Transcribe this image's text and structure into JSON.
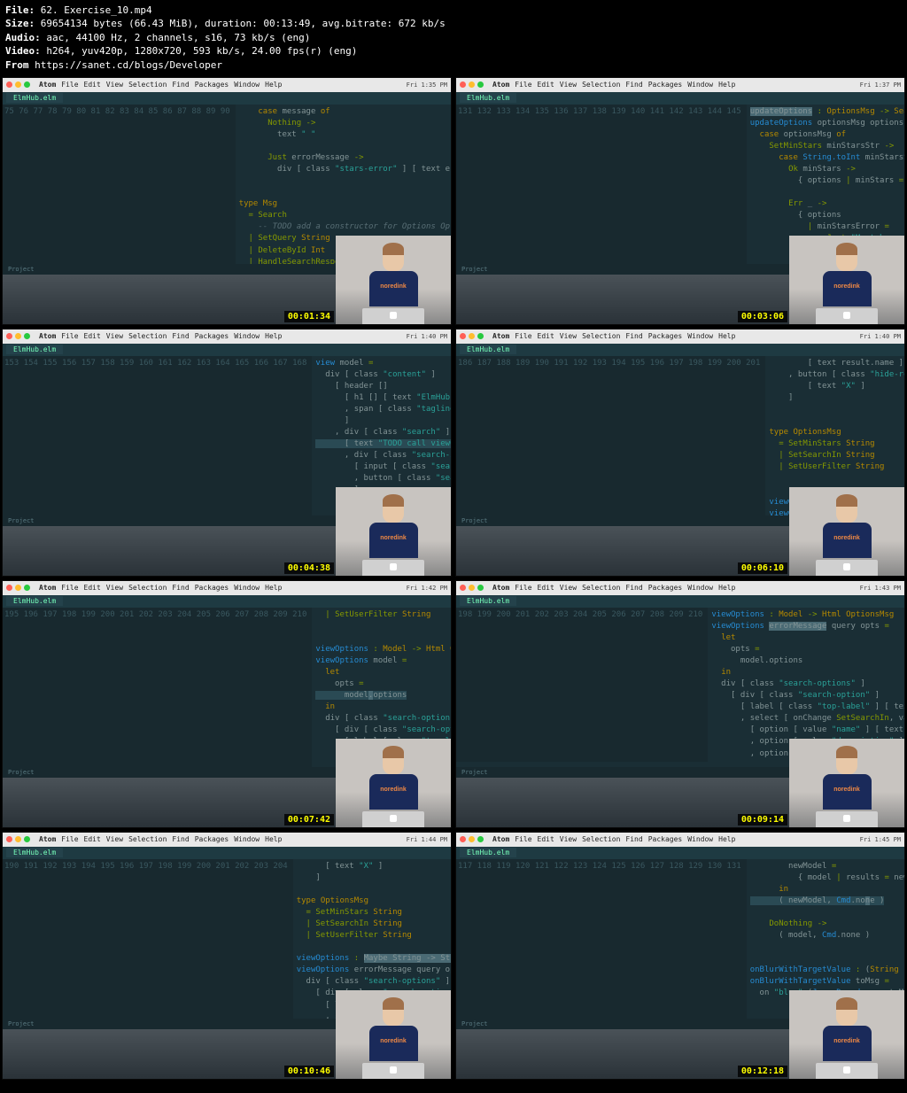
{
  "header": {
    "file_label": "File:",
    "file": "62. Exercise_10.mp4",
    "size_label": "Size:",
    "size": "69654134 bytes (66.43 MiB), duration: 00:13:49, avg.bitrate: 672 kb/s",
    "audio_label": "Audio:",
    "audio": "aac, 44100 Hz, 2 channels, s16, 73 kb/s (eng)",
    "video_label": "Video:",
    "video": "h264, yuv420p, 1280x720, 593 kb/s, 24.00 fps(r) (eng)",
    "from_label": "From",
    "from": "https://sanet.cd/blogs/Developer"
  },
  "menubar": {
    "app": "Atom",
    "items": [
      "File",
      "Edit",
      "View",
      "Selection",
      "Find",
      "Packages",
      "Window",
      "Help"
    ]
  },
  "clock_times": [
    "Fri 1:35 PM",
    "Fri 1:37 PM",
    "Fri 1:40 PM",
    "Fri 1:40 PM",
    "Fri 1:42 PM",
    "Fri 1:43 PM",
    "Fri 1:44 PM",
    "Fri 1:45 PM"
  ],
  "tab": "ElmHub.elm",
  "shirt_logo": "noredink",
  "thumbs": [
    {
      "timestamp": "00:01:34",
      "line_start": 75,
      "code": "    <span class='kw'>case</span> message <span class='kw'>of</span>\n      <span class='ctor'>Nothing</span> <span class='op'>-&gt;</span>\n        text <span class='str'>\" \"</span>\n\n      <span class='ctor'>Just</span> errorMessage <span class='op'>-&gt;</span>\n        div [ class <span class='str'>\"stars-error\"</span> ] [ text errorMessage ]\n\n\n<span class='kw'>type</span> <span class='type'>Msg</span>\n  <span class='op'>=</span> <span class='ctor'>Search</span>\n    <span class='cmt'>-- TODO add a constructor for Options OptionsMsg</span>\n  <span class='op'>|</span> <span class='ctor'>SetQuery</span> <span class='type'>String</span>\n  <span class='op'>|</span> <span class='ctor'>DeleteById</span> <span class='type'>Int</span>\n  <span class='op'>|</span> <span class='ctor'>HandleSearchResponse</span> (<span class='type'>List</span> <span class='type'>SearchResult</span>)\n  <span class='op'>|</span> <span class='ctor'>HandleSearchError</span> (<span class='type'>Maybe</span> <span class='type'>String</span>)\n  <span class='op'>|</span> <span class='ctor'>DoNothing</span>"
    },
    {
      "timestamp": "00:03:06",
      "line_start": 131,
      "code": "<span class='sel'>updateOptions</span> <span class='op'>:</span> <span class='type'>OptionsMsg</span> <span class='op'>-&gt;</span> <span class='type'>SearchOptions</span> <span class='op'>-&gt;</span> <span class='type'>SearchOptions</span>\n<span class='fn'>updateOptions</span> optionsMsg options <span class='op'>=</span>\n  <span class='kw'>case</span> optionsMsg <span class='kw'>of</span>\n    <span class='ctor'>SetMinStars</span> minStarsStr <span class='op'>-&gt;</span>\n      <span class='kw'>case</span> <span class='fn'>String.toInt</span> minStarsStr <span class='kw'>of</span>\n        <span class='ctor'>Ok</span> minStars <span class='op'>-&gt;</span>\n          { options <span class='op'>|</span> minStars <span class='op'>=</span> minStars, minStarsError <span class='op'>=</span> <span class='ctor'>Nothing</span> }\n\n        <span class='ctor'>Err</span> _ <span class='op'>-&gt;</span>\n          { options\n            <span class='op'>|</span> minStarsError <span class='op'>=</span>\n                <span class='ctor'>Just</span> <span class='str'>\"Must be an integer!\"</span>\n          }\n\n    <span class='ctor'>SetSearchIn</span> searchIn <span class='op'>-&gt;</span>"
    },
    {
      "timestamp": "00:04:38",
      "line_start": 153,
      "code": "<span class='fn'>view</span> model <span class='op'>=</span>\n  div [ class <span class='str'>\"content\"</span> ]\n    [ header []\n      [ h1 [] [ text <span class='str'>\"ElmHub\"</span> ]\n      , span [ class <span class='str'>\"tagline\"</span> ] [ text <span class='str'>\"Like GitHub, but for Elm things.\"</span>\n      ]\n    , div [ class <span class='str'>\"search\"</span> ]\n<span class='hl'>      [ text <span class='str'>\"TODO call viewOptions here. Use Html.map to avoid a type mis</span></span>\n      , div [ class <span class='str'>\"search-input\"</span> ]\n        [ input [ class <span class='str'>\"search-query\"</span>, onInput <span class='ctor'>SetQuery</span>, defaultValue m\n        , button [ class <span class='str'>\"search-button\"</span>, onClick <span class='ctor'>Search</span> ] [ text <span class='str'>\"Searc</span>\n        ]\n      ]\n    , viewErrorMessage model.errorMessage\n    , ul [ class <span class='str'>\"results\"</span> ] (<span class='fn'>List.map</span> viewSearchResult model.results)\n    ]"
    },
    {
      "timestamp": "00:06:10",
      "line_start": 186,
      "code": "        [ text result.name ]\n    , button [ class <span class='str'>\"hide-result\"</span>, onClick (<span class='ctor'>DeleteById</span> result.id)\n        [ text <span class='str'>\"X\"</span> ]\n    ]\n\n\n<span class='kw'>type</span> <span class='type'>OptionsMsg</span>\n  <span class='op'>=</span> <span class='ctor'>SetMinStars</span> <span class='type'>String</span>\n  <span class='op'>|</span> <span class='ctor'>SetSearchIn</span> <span class='type'>String</span>\n  <span class='op'>|</span> <span class='ctor'>SetUserFilter</span> <span class='type'>String</span>\n\n\n<span class='fn'>viewOptions</span> <span class='op'>:</span> <span class='sel'>SearchOptions</span> <span class='op'>-&gt;</span> <span class='type'>Html</span> <span class='type'>OptionsMsg</span>\n<span class='fn'>viewOptions</span> opts <span class='op'>=</span>\n  div [ class <span class='str'>\"search-options\"</span> ]\n    [ div [ class <span class='str'>\"search-option\"</span> ]"
    },
    {
      "timestamp": "00:07:42",
      "line_start": 195,
      "code": "  <span class='op'>|</span> <span class='ctor'>SetUserFilter</span> <span class='type'>String</span>\n\n\n<span class='fn'>viewOptions</span> <span class='op'>:</span> <span class='type'>Model</span> <span class='op'>-&gt;</span> <span class='type'>Html</span> <span class='type'>OptionsMsg</span>\n<span class='fn'>viewOptions</span> model <span class='op'>=</span>\n  <span class='kw'>let</span>\n    opts <span class='op'>=</span>\n<span class='hl'>      model<span class='sel'>.</span>options</span>\n  <span class='kw'>in</span>\n  div [ class <span class='str'>\"search-options\"</span> ]\n    [ div [ class <span class='str'>\"search-option\"</span> ]\n      [ label [ class <span class='str'>\"top-label\"</span> ] [ text <span class='str'>\"Search in\"</span> ]\n      , select [ onChange <span class='ctor'>SetSearchIn</span>, value opts.searchIn ]\n        [ option [ value <span class='str'>\"name\"</span> ] [ text <span class='str'>\"Name\"</span> ]\n        , option [ value <span class='str'>\"description\"</span> ] [ text <span class='str'>\"Description\"</span> ]\n        , option [ value <span class='str'>\"name,description\"</span> ] [ text <span class='str'>\"Name and Descr</span>"
    },
    {
      "timestamp": "00:09:14",
      "line_start": 198,
      "code": "<span class='fn'>viewOptions</span> <span class='op'>:</span> <span class='type'>Model</span> <span class='op'>-&gt;</span> <span class='type'>Html</span> <span class='type'>OptionsMsg</span>\n<span class='fn'>viewOptions</span> <span class='sel'>errorMessage</span> query opts <span class='op'>=</span>\n  <span class='kw'>let</span>\n    opts <span class='op'>=</span>\n      model.options\n  <span class='kw'>in</span>\n  div [ class <span class='str'>\"search-options\"</span> ]\n    [ div [ class <span class='str'>\"search-option\"</span> ]\n      [ label [ class <span class='str'>\"top-label\"</span> ] [ text <span class='str'>\"Search in\"</span> ]\n      , select [ onChange <span class='ctor'>SetSearchIn</span>, value opts.searchIn ]\n        [ option [ value <span class='str'>\"name\"</span> ] [ text <span class='str'>\"Name\"</span> ]\n        , option [ value <span class='str'>\"description\"</span> ] [ text <span class='str'>\"Description\"</span> ]\n        , option [ value <span class='str'>\"name,description\"</span> ] [ text <span class='str'>\"Name and Descri</span>"
    },
    {
      "timestamp": "00:10:46",
      "line_start": 190,
      "code": "      [ text <span class='str'>\"X\"</span> ]\n    ]\n\n<span class='kw'>type</span> <span class='type'>OptionsMsg</span>\n  <span class='op'>=</span> <span class='ctor'>SetMinStars</span> <span class='type'>String</span>\n  <span class='op'>|</span> <span class='ctor'>SetSearchIn</span> <span class='type'>String</span>\n  <span class='op'>|</span> <span class='ctor'>SetUserFilter</span> <span class='type'>String</span>\n\n<span class='fn'>viewOptions</span> <span class='op'>:</span> <span class='sel'>Maybe String -&gt; String</span> <span class='op'>-&gt;</span> <span class='type'>SearchOptions</span> <span class='op'>-&gt;</span> <span class='type'>Html</span> <span class='type'>OptionsMsg</span>\n<span class='fn'>viewOptions</span> errorMessage query opts <span class='op'>=</span>\n  div [ class <span class='str'>\"search-options\"</span> ]\n    [ div [ class <span class='str'>\"search-option\"</span> ]\n      [ label [ class <span class='str'>\"top-label\"</span> ] [ text <span class='str'>\"Search in\"</span> ]\n      , select [ onChange <span class='ctor'>SetSearchIn</span>, value opts.searchIn ]\n        [ option [ value <span class='str'>\"name\"</span> ] [ text <span class='str'>\"Name\"</span> ]"
    },
    {
      "timestamp": "00:12:18",
      "line_start": 117,
      "code": "        newModel <span class='op'>=</span>\n          { model <span class='op'>|</span> results <span class='op'>=</span> newResults }\n      <span class='kw'>in</span>\n<span class='hl'>      ( newModel, <span class='fn'>Cmd</span>.no<span class='sel'>n</span>e )</span>\n\n    <span class='ctor'>DoNothing</span> <span class='op'>-&gt;</span>\n      ( model, <span class='fn'>Cmd</span>.none )\n\n\n<span class='fn'>onBlurWithTargetValue</span> <span class='op'>:</span> (<span class='type'>String</span> <span class='op'>-&gt;</span> msg) <span class='op'>-&gt;</span> <span class='type'>Attribute</span> msg\n<span class='fn'>onBlurWithTargetValue</span> toMsg <span class='op'>=</span>\n  on <span class='str'>\"blur\"</span> (<span class='fn'>Json.Decode.map</span> toMsg targetValue)\n\n\n<span class='fn'>updateOptions</span> <span class='op'>:</span> <span class='type'>OptionsMsg</span> <span class='op'>-&gt;</span> <span class='type'>SearchOptions</span> <span class='op'>-&gt;</span> <span class='type'>SearchOptions</span>"
    }
  ]
}
